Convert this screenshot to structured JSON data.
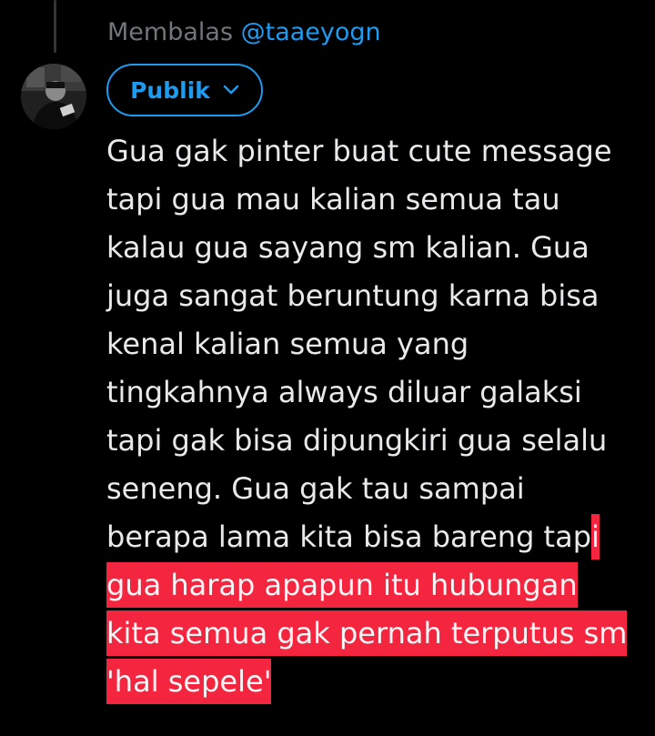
{
  "reply": {
    "prefix": "Membalas",
    "handle": "@taaeyogn"
  },
  "audience": {
    "label": "Publik",
    "icon": "chevron-down-icon"
  },
  "tweet": {
    "lines": [
      "Gua gak pinter buat cute message",
      "tapi gua mau kalian semua tau",
      "kalau gua sayang sm kalian. Gua",
      "juga sangat beruntung karna bisa",
      "kenal kalian semua yang",
      "tingkahnya always diluar galaksi",
      "tapi gak bisa dipungkiri gua selalu",
      "seneng. Gua gak tau sampai",
      "berapa lama kita bisa bareng tap"
    ],
    "highlight_start": "i",
    "highlight_lines": [
      "gua harap apapun itu hubungan",
      "kita semua gak pernah terputus sm",
      "'hal sepele'"
    ],
    "highlight_color": "#f4253f"
  },
  "colors": {
    "background": "#000000",
    "text": "#e7e9ea",
    "muted": "#71767b",
    "accent": "#1d9bf0"
  }
}
